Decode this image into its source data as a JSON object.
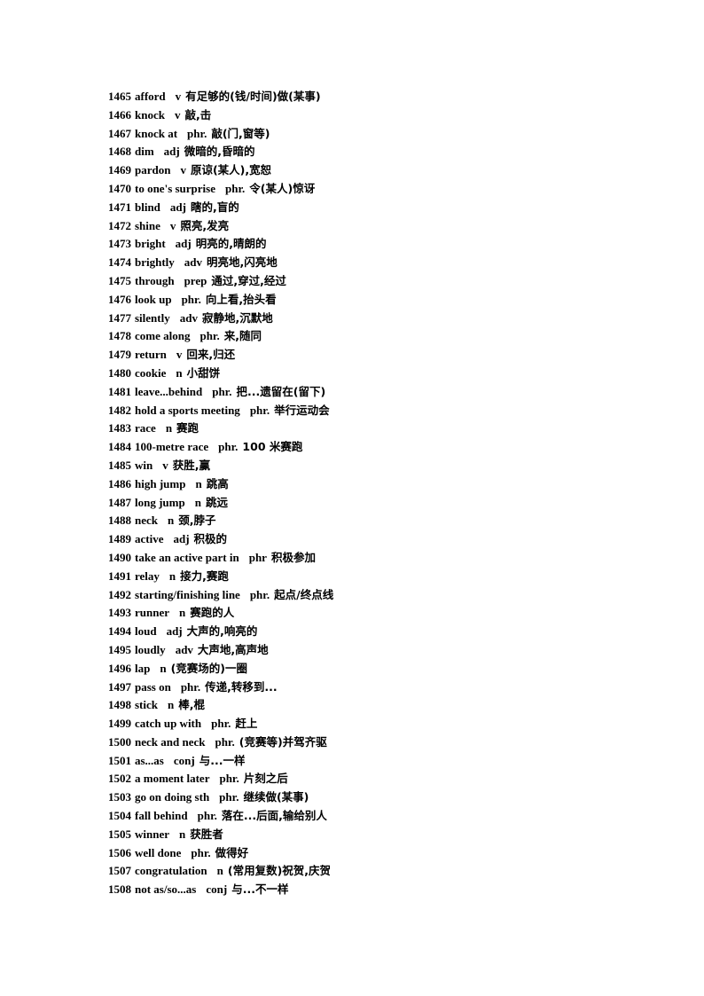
{
  "document": {
    "type": "vocabulary-list",
    "text_color": "#000000",
    "background_color": "#ffffff"
  },
  "entries": [
    {
      "num": "1465",
      "word": "afford",
      "pos": "v",
      "cn": "有足够的(钱/时间)做(某事)"
    },
    {
      "num": "1466",
      "word": "knock",
      "pos": "v",
      "cn": "敲,击"
    },
    {
      "num": "1467",
      "word": "knock at",
      "pos": "phr.",
      "cn": "敲(门,窗等)"
    },
    {
      "num": "1468",
      "word": "dim",
      "pos": "adj",
      "cn": "微暗的,昏暗的"
    },
    {
      "num": "1469",
      "word": "pardon",
      "pos": "v",
      "cn": "原谅(某人),宽恕"
    },
    {
      "num": "1470",
      "word": "to one's surprise",
      "pos": "phr.",
      "cn": "令(某人)惊讶"
    },
    {
      "num": "1471",
      "word": "blind",
      "pos": "adj",
      "cn": "瞎的,盲的"
    },
    {
      "num": "1472",
      "word": "shine",
      "pos": "v",
      "cn": "照亮,发亮"
    },
    {
      "num": "1473",
      "word": "bright",
      "pos": "adj",
      "cn": "明亮的,晴朗的"
    },
    {
      "num": "1474",
      "word": "brightly",
      "pos": "adv",
      "cn": "明亮地,闪亮地"
    },
    {
      "num": "1475",
      "word": "through",
      "pos": "prep",
      "cn": "通过,穿过,经过"
    },
    {
      "num": "1476",
      "word": "look up",
      "pos": "phr.",
      "cn": "向上看,抬头看"
    },
    {
      "num": "1477",
      "word": "silently",
      "pos": "adv",
      "cn": "寂静地,沉默地"
    },
    {
      "num": "1478",
      "word": "come along",
      "pos": "phr.",
      "cn": "来,随同"
    },
    {
      "num": "1479",
      "word": "return",
      "pos": "v",
      "cn": "回来,归还"
    },
    {
      "num": "1480",
      "word": "cookie",
      "pos": "n",
      "cn": "小甜饼"
    },
    {
      "num": "1481",
      "word": "leave...behind",
      "pos": "phr.",
      "cn": "把...遗留在(留下)"
    },
    {
      "num": "1482",
      "word": "hold a sports meeting",
      "pos": "phr.",
      "cn": "举行运动会"
    },
    {
      "num": "1483",
      "word": "race",
      "pos": "n",
      "cn": "赛跑"
    },
    {
      "num": "1484",
      "word": "100-metre race",
      "pos": "phr.",
      "cn": "100 米赛跑"
    },
    {
      "num": "1485",
      "word": "win",
      "pos": "v",
      "cn": "获胜,赢"
    },
    {
      "num": "1486",
      "word": "high jump",
      "pos": "n",
      "cn": "跳高"
    },
    {
      "num": "1487",
      "word": "long jump",
      "pos": "n",
      "cn": "跳远"
    },
    {
      "num": "1488",
      "word": "neck",
      "pos": "n",
      "cn": "颈,脖子"
    },
    {
      "num": "1489",
      "word": "active",
      "pos": "adj",
      "cn": "积极的"
    },
    {
      "num": "1490",
      "word": "take an active part in",
      "pos": "phr",
      "cn": "积极参加"
    },
    {
      "num": "1491",
      "word": "relay",
      "pos": "n",
      "cn": "接力,赛跑"
    },
    {
      "num": "1492",
      "word": "starting/finishing line",
      "pos": "phr.",
      "cn": "起点/终点线"
    },
    {
      "num": "1493",
      "word": "runner",
      "pos": "n",
      "cn": "赛跑的人"
    },
    {
      "num": "1494",
      "word": "loud",
      "pos": "adj",
      "cn": "大声的,响亮的"
    },
    {
      "num": "1495",
      "word": "loudly",
      "pos": "adv",
      "cn": "大声地,高声地"
    },
    {
      "num": "1496",
      "word": "lap",
      "pos": "n",
      "cn": "(竞赛场的)一圈"
    },
    {
      "num": "1497",
      "word": "pass on",
      "pos": "phr.",
      "cn": "传递,转移到..."
    },
    {
      "num": "1498",
      "word": "stick",
      "pos": "n",
      "cn": "棒,棍"
    },
    {
      "num": "1499",
      "word": "catch up with",
      "pos": "phr.",
      "cn": "赶上"
    },
    {
      "num": "1500",
      "word": "neck and neck",
      "pos": "phr.",
      "cn": "(竞赛等)并驾齐驱"
    },
    {
      "num": "1501",
      "word": "as...as",
      "pos": "conj",
      "cn": "与...一样"
    },
    {
      "num": "1502",
      "word": "a moment later",
      "pos": "phr.",
      "cn": "片刻之后"
    },
    {
      "num": "1503",
      "word": "go on doing sth",
      "pos": "phr.",
      "cn": "继续做(某事)"
    },
    {
      "num": "1504",
      "word": "fall behind",
      "pos": "phr.",
      "cn": "落在...后面,输给别人"
    },
    {
      "num": "1505",
      "word": "winner",
      "pos": "n",
      "cn": "获胜者"
    },
    {
      "num": "1506",
      "word": "well done",
      "pos": "phr.",
      "cn": "做得好"
    },
    {
      "num": "1507",
      "word": "congratulation",
      "pos": "n",
      "cn": "(常用复数)祝贺,庆贺"
    },
    {
      "num": "1508",
      "word": "not as/so...as",
      "pos": "conj",
      "cn": "与...不一样"
    }
  ]
}
